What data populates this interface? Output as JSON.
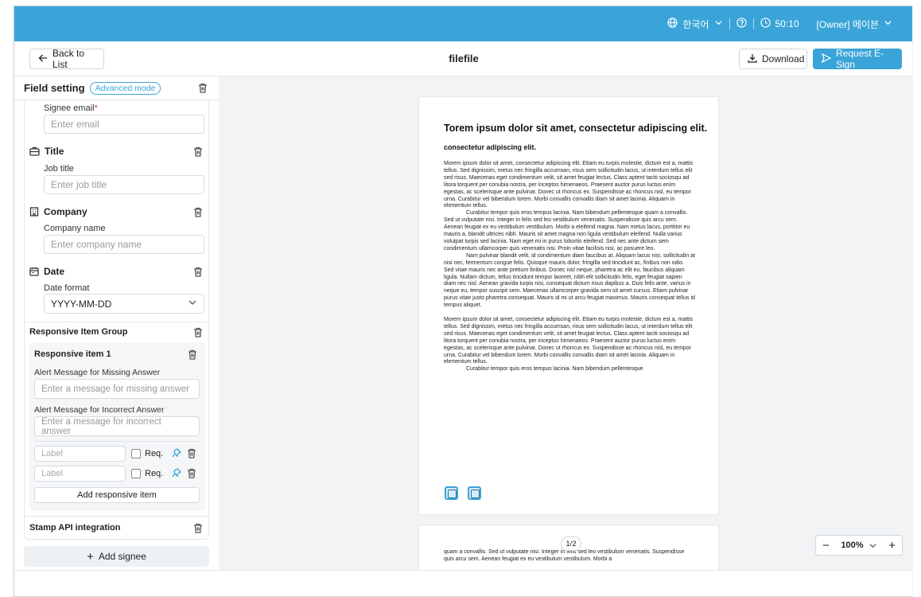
{
  "topbar": {
    "language": "한국어",
    "timer": "50:10",
    "user": "[Owner] 메이븐"
  },
  "header": {
    "back_label": "Back to List",
    "doc_title": "filefile",
    "download_label": "Download",
    "esign_label": "Request E-Sign"
  },
  "sidebar": {
    "title": "Field setting",
    "badge": "Advanced mode",
    "signee_email_label": "Signee email",
    "signee_email_placeholder": "Enter email",
    "title_section": "Title",
    "job_title_label": "Job title",
    "job_title_placeholder": "Enter job title",
    "company_section": "Company",
    "company_name_label": "Company name",
    "company_placeholder": "Enter company name",
    "date_section": "Date",
    "date_format_label": "Date format",
    "date_format_value": "YYYY-MM-DD",
    "group_section": "Responsive Item Group",
    "item_title": "Responsive item 1",
    "missing_label": "Alert Message for Missing Answer",
    "missing_placeholder": "Enter a message for missing answer",
    "incorrect_label": "Alert Message for Incorrect Answer",
    "incorrect_placeholder": "Enter a message for incorrect answer",
    "label_placeholder": "Label",
    "req_label": "Req.",
    "add_item": "Add responsive item",
    "stamp_section": "Stamp API integration",
    "add_signee": "Add signee"
  },
  "document": {
    "heading": "Torem ipsum dolor sit amet, consectetur adipiscing elit.",
    "subheading": "consectetur adipiscing elit.",
    "para1": "Morem ipsum dolor sit amet, consectetur adipiscing elit. Etiam eu turpis molestie, dictum est a, mattis tellus. Sed dignissim, metus nec fringilla accumsan, risus sem sollicitudin lacus, ut interdum tellus elit sed risus. Maecenas eget condimentum velit, sit amet feugiat lectus. Class aptent taciti sociosqu ad litora torquent per conubia nostra, per inceptos himenaeos. Praesent auctor purus luctus enim egestas, ac scelerisque ante pulvinar. Donec ut rhoncus ex. Suspendisse ac rhoncus nisl, eu tempor urna. Curabitur vel bibendum lorem. Morbi convallis convallis diam sit amet lacinia. Aliquam in elementum tellus.",
    "para2": "Curabitur tempor quis eros tempus lacinia. Nam bibendum pellentesque quam a convallis. Sed ut vulputate nisi. Integer in felis sed leo vestibulum venenatis. Suspendisse quis arcu sem. Aenean feugiat ex eu vestibulum vestibulum. Morbi a eleifend magna. Nam metus lacus, porttitor eu mauris a, blandit ultrices nibh. Mauris sit amet magna non ligula vestibulum eleifend. Nulla varius volutpat turpis sed lacinia. Nam eget mi in purus lobortis eleifend. Sed nec ante dictum sem condimentum ullamcorper quis venenatis nisi. Proin vitae facilisis nisi, ac posuere leo.",
    "para3": "Nam pulvinar blandit velit, id condimentum diam faucibus at. Aliquam lacus nisi, sollicitudin at nisi nec, fermentum congue felis. Quisque mauris dolor, fringilla sed tincidunt ac, finibus non odio. Sed vitae mauris nec ante pretium finibus. Donec nisl neque, pharetra ac elit eu, faucibus aliquam ligula. Nullam dictum, tellus tincidunt tempor laoreet, nibh elit sollicitudin felis, eget feugiat sapien diam nec nisl. Aenean gravida turpis nisi, consequat dictum risus dapibus a. Duis felis ante, varius in neque eu, tempor suscipit sem. Maecenas ullamcorper gravida sem sit amet cursus. Etiam pulvinar purus vitae justo pharetra consequat. Mauris id mi ut arcu feugiat maximus. Mauris consequat tellus id tempus aliquet.",
    "para4": "Morem ipsum dolor sit amet, consectetur adipiscing elit. Etiam eu turpis molestie, dictum est a, mattis tellus. Sed dignissim, metus nec fringilla accumsan, risus sem sollicitudin lacus, ut interdum tellus elit sed risus. Maecenas eget condimentum velit, sit amet feugiat lectus. Class aptent taciti sociosqu ad litora torquent per conubia nostra, per inceptos himenaeos. Praesent auctor purus luctus enim egestas, ac scelerisque ante pulvinar. Donec ut rhoncus ex. Suspendisse ac rhoncus nisl, eu tempor urna. Curabitur vel bibendum lorem. Morbi convallis convallis diam sit amet lacinia. Aliquam in elementum tellus.",
    "para5": "Curabitur tempor quis eros tempus lacinia. Nam bibendum pellentesque",
    "page2_text": "quam a convallis. Sed ut vulputate nisi. Integer in felis sed leo vestibulum venenatis. Suspendisse quis arcu sem. Aenean feugiat ex eu vestibulum vestibulum. Morbi a"
  },
  "pager": "1/2",
  "zoom": "100%",
  "colors": {
    "accent": "#3aa4d8"
  }
}
